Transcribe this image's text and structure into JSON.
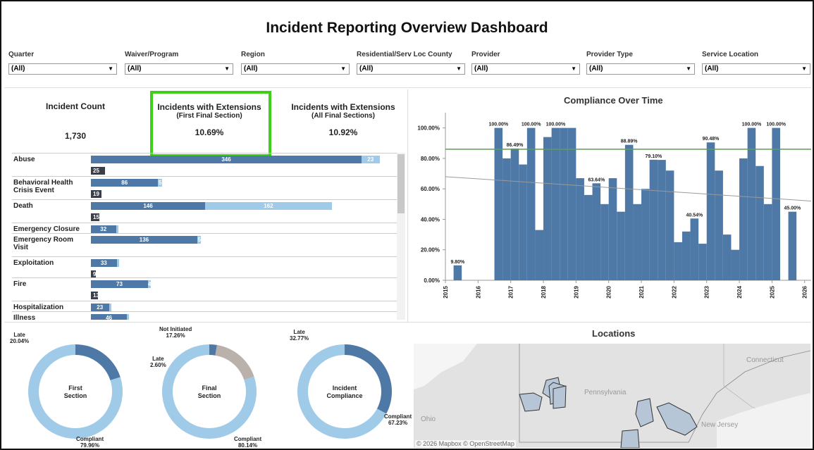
{
  "dashboard": {
    "title": "Incident Reporting Overview Dashboard"
  },
  "filters": [
    {
      "label": "Quarter",
      "value": "(All)"
    },
    {
      "label": "Waiver/Program",
      "value": "(All)"
    },
    {
      "label": "Region",
      "value": "(All)"
    },
    {
      "label": "Residential/Serv Loc County",
      "value": "(All)"
    },
    {
      "label": "Provider",
      "value": "(All)"
    },
    {
      "label": "Provider Type",
      "value": "(All)"
    },
    {
      "label": "Service Location",
      "value": "(All)"
    }
  ],
  "kpis": {
    "incident_count": {
      "title": "Incident Count",
      "value": "1,730"
    },
    "ext_first": {
      "title": "Incidents with Extensions",
      "subtitle": "(First Final Section)",
      "value": "10.69%"
    },
    "ext_all": {
      "title": "Incidents with Extensions",
      "subtitle": "(All Final Sections)",
      "value": "10.92%"
    }
  },
  "colors": {
    "primary": "#4e79a7",
    "light": "#a0cbe8",
    "dark": "#3a3f4a",
    "grey": "#bab0ac",
    "highlight": "#3ecf1b",
    "target_line": "#59a14f",
    "trend_line": "#9a9a9a"
  },
  "chart_data": [
    {
      "type": "bar",
      "title": "",
      "categories": [
        "Abuse",
        "Behavioral Health Crisis Event",
        "Death",
        "Emergency Closure",
        "Emergency Room Visit",
        "Exploitation",
        "Fire",
        "Hospitalization",
        "Illness"
      ],
      "series": [
        {
          "values": [
            346,
            86,
            146,
            32,
            136,
            33,
            73,
            23,
            46
          ],
          "labels": [
            "346",
            "86",
            "146",
            "32",
            "136",
            "33",
            "73",
            "23",
            "46"
          ]
        },
        {
          "values": [
            23,
            5,
            162,
            2,
            5,
            1,
            4,
            2,
            3
          ],
          "labels": [
            "23",
            "5",
            "162",
            "",
            "5",
            "",
            "4",
            "",
            ""
          ]
        },
        {
          "values": [
            25,
            19,
            15,
            null,
            null,
            9,
            13,
            null,
            null
          ],
          "labels": [
            "25",
            "19",
            "15",
            "",
            "",
            "9",
            "13",
            "",
            ""
          ]
        }
      ]
    },
    {
      "type": "bar",
      "title": "Compliance Over Time",
      "xlabel": "",
      "ylabel": "",
      "x_ticks": [
        "2015",
        "2016",
        "2017",
        "2018",
        "2019",
        "2020",
        "2021",
        "2022",
        "2023",
        "2024",
        "2025",
        "2026"
      ],
      "y_ticks": [
        "0.00%",
        "20.00%",
        "40.00%",
        "60.00%",
        "80.00%",
        "100.00%"
      ],
      "ylim": [
        0,
        110
      ],
      "xlim": [
        2015,
        2026.2
      ],
      "bars": [
        {
          "x": 2015.25,
          "y": 9.8,
          "label": "9.80%"
        },
        {
          "x": 2016.5,
          "y": 100,
          "label": "100.00%"
        },
        {
          "x": 2016.75,
          "y": 80,
          "label": ""
        },
        {
          "x": 2017.0,
          "y": 86.49,
          "label": "86.49%"
        },
        {
          "x": 2017.25,
          "y": 76,
          "label": ""
        },
        {
          "x": 2017.5,
          "y": 100,
          "label": "100.00%"
        },
        {
          "x": 2017.75,
          "y": 33,
          "label": ""
        },
        {
          "x": 2018.0,
          "y": 94,
          "label": ""
        },
        {
          "x": 2018.25,
          "y": 100,
          "label": "100.00%"
        },
        {
          "x": 2018.5,
          "y": 100,
          "label": ""
        },
        {
          "x": 2018.75,
          "y": 100,
          "label": ""
        },
        {
          "x": 2019.0,
          "y": 67,
          "label": ""
        },
        {
          "x": 2019.25,
          "y": 56,
          "label": ""
        },
        {
          "x": 2019.5,
          "y": 63.64,
          "label": "63.64%"
        },
        {
          "x": 2019.75,
          "y": 50,
          "label": ""
        },
        {
          "x": 2020.0,
          "y": 67,
          "label": ""
        },
        {
          "x": 2020.25,
          "y": 45,
          "label": ""
        },
        {
          "x": 2020.5,
          "y": 88.89,
          "label": "88.89%"
        },
        {
          "x": 2020.75,
          "y": 50,
          "label": ""
        },
        {
          "x": 2021.0,
          "y": 60,
          "label": ""
        },
        {
          "x": 2021.25,
          "y": 79.1,
          "label": "79.10%"
        },
        {
          "x": 2021.5,
          "y": 79,
          "label": ""
        },
        {
          "x": 2021.75,
          "y": 72,
          "label": ""
        },
        {
          "x": 2022.0,
          "y": 25,
          "label": ""
        },
        {
          "x": 2022.25,
          "y": 32,
          "label": ""
        },
        {
          "x": 2022.5,
          "y": 40.54,
          "label": "40.54%"
        },
        {
          "x": 2022.75,
          "y": 24,
          "label": ""
        },
        {
          "x": 2023.0,
          "y": 90.48,
          "label": "90.48%"
        },
        {
          "x": 2023.25,
          "y": 72,
          "label": ""
        },
        {
          "x": 2023.5,
          "y": 30,
          "label": ""
        },
        {
          "x": 2023.75,
          "y": 20,
          "label": ""
        },
        {
          "x": 2024.0,
          "y": 80,
          "label": ""
        },
        {
          "x": 2024.25,
          "y": 100,
          "label": "100.00%"
        },
        {
          "x": 2024.5,
          "y": 75,
          "label": ""
        },
        {
          "x": 2024.75,
          "y": 50,
          "label": ""
        },
        {
          "x": 2025.0,
          "y": 100,
          "label": "100.00%"
        },
        {
          "x": 2025.5,
          "y": 45,
          "label": "45.00%"
        }
      ],
      "target_line": 86,
      "trend_line": [
        [
          2015,
          68
        ],
        [
          2026.2,
          52
        ]
      ]
    },
    {
      "type": "pie",
      "title": "",
      "center_label": "First Section",
      "slices": [
        {
          "name": "Late",
          "value": 20.04,
          "label": "20.04%",
          "color": "#4e79a7"
        },
        {
          "name": "Compliant",
          "value": 79.96,
          "label": "79.96%",
          "color": "#a0cbe8"
        }
      ]
    },
    {
      "type": "pie",
      "title": "",
      "center_label": "Final Section",
      "slices": [
        {
          "name": "Late",
          "value": 2.6,
          "label": "2.60%",
          "color": "#4e79a7"
        },
        {
          "name": "Not Initiated",
          "value": 17.26,
          "label": "17.26%",
          "color": "#bab0ac"
        },
        {
          "name": "Compliant",
          "value": 80.14,
          "label": "80.14%",
          "color": "#a0cbe8"
        }
      ]
    },
    {
      "type": "pie",
      "title": "",
      "center_label": "Incident Compliance",
      "slices": [
        {
          "name": "Late",
          "value": 32.77,
          "label": "32.77%",
          "color": "#4e79a7"
        },
        {
          "name": "Compliant",
          "value": 67.23,
          "label": "67.23%",
          "color": "#a0cbe8"
        }
      ]
    }
  ],
  "map": {
    "title": "Locations",
    "labels": [
      "Connecticut",
      "Pennsylvania",
      "Ohio",
      "New Jersey"
    ],
    "attribution": "© 2026 Mapbox © OpenStreetMap"
  }
}
